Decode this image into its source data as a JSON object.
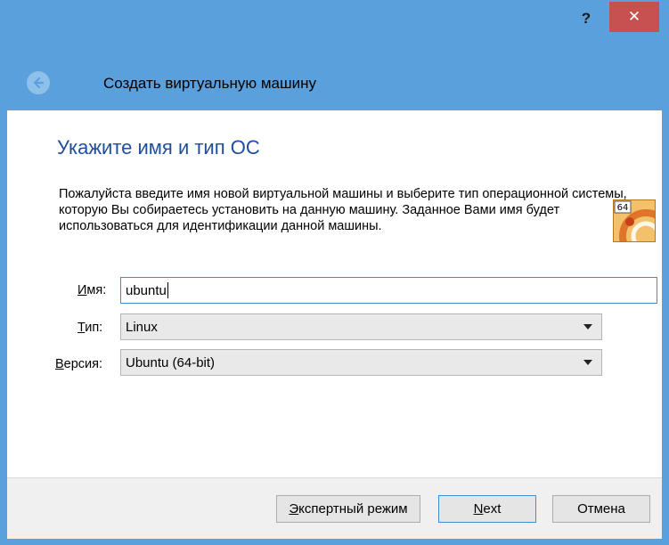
{
  "titlebar": {
    "help_label": "?",
    "close_label": "✕"
  },
  "header": {
    "title": "Создать виртуальную машину",
    "back_icon": "back-arrow-icon"
  },
  "page": {
    "title": "Укажите имя и тип ОС",
    "description": "Пожалуйста введите имя новой виртуальной машины и выберите тип операционной системы, которую Вы собираетесь установить на данную машину. Заданное Вами имя будет использоваться для идентификации данной машины."
  },
  "form": {
    "name": {
      "label_access_key": "И",
      "label_rest": "мя:",
      "value": "ubuntu"
    },
    "type": {
      "label_access_key": "Т",
      "label_rest": "ип:",
      "value": "Linux"
    },
    "version": {
      "label_access_key": "В",
      "label_rest": "ерсия:",
      "value": "Ubuntu (64-bit)"
    },
    "os_icon": {
      "name": "ubuntu-64-os-icon",
      "badge": "64"
    }
  },
  "footer": {
    "expert": {
      "access_key": "Э",
      "rest": "кспертный режим"
    },
    "next": {
      "access_key": "N",
      "rest": "ext"
    },
    "cancel": "Отмена"
  },
  "colors": {
    "frame": "#5aa0dc",
    "close": "#c75050",
    "title": "#1e4e9e",
    "focus": "#3c8ed7"
  }
}
